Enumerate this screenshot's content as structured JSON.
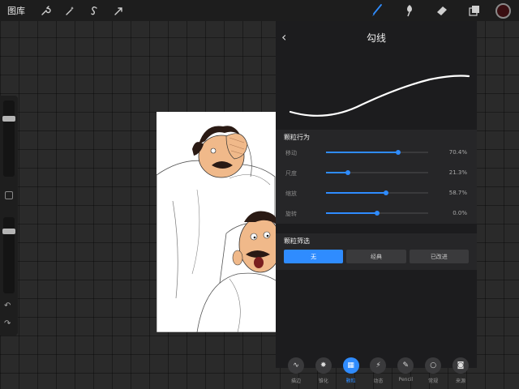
{
  "toolbar": {
    "gallery": "图库",
    "left_icons": [
      "wrench-icon",
      "magic-wand-icon",
      "selection-icon",
      "transform-arrow-icon"
    ],
    "right_icons": [
      "brush-icon",
      "smudge-icon",
      "eraser-icon",
      "layers-icon"
    ],
    "active_tool": "brush-icon",
    "current_color": "#3a0f12"
  },
  "sidebar": {
    "brush_size": 0.22,
    "brush_opacity": 0.16
  },
  "panel": {
    "title": "勾线",
    "grain_behavior": {
      "title": "颗粒行为",
      "rows": [
        {
          "label": "移动",
          "value": "70.4%",
          "fraction": 0.704
        },
        {
          "label": "尺度",
          "value": "21.3%",
          "fraction": 0.213
        },
        {
          "label": "缩放",
          "value": "58.7%",
          "fraction": 0.587
        },
        {
          "label": "旋转",
          "value": "0.0%",
          "fraction": 0.5
        }
      ]
    },
    "grain_filtering": {
      "title": "颗粒筛选",
      "options": [
        "无",
        "经典",
        "已改进"
      ],
      "selected": "无"
    }
  },
  "tabs": [
    {
      "label": "描边",
      "icon": "stroke-icon"
    },
    {
      "label": "锥化",
      "icon": "taper-icon"
    },
    {
      "label": "颗粒",
      "icon": "grain-icon",
      "active": true
    },
    {
      "label": "动态",
      "icon": "dynamics-icon"
    },
    {
      "label": "Pencil",
      "icon": "pencil-icon"
    },
    {
      "label": "常规",
      "icon": "general-icon"
    },
    {
      "label": "来源",
      "icon": "source-icon"
    }
  ],
  "colors": {
    "accent": "#2f8cff",
    "panel": "#1c1c1e",
    "section": "#262628"
  }
}
